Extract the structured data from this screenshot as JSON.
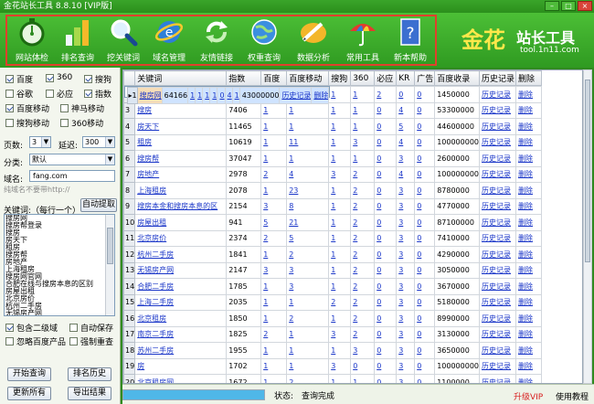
{
  "window": {
    "title": "金花站长工具 8.8.10 [VIP版]"
  },
  "toolbar": {
    "items": [
      {
        "label": "网站体检",
        "icon": "stopwatch-icon"
      },
      {
        "label": "排名查询",
        "icon": "bar-chart-icon"
      },
      {
        "label": "挖关键词",
        "icon": "magnifier-icon"
      },
      {
        "label": "域名管理",
        "icon": "ie-globe-icon"
      },
      {
        "label": "友情链接",
        "icon": "refresh-icon"
      },
      {
        "label": "权重查询",
        "icon": "globe-icon"
      },
      {
        "label": "数据分析",
        "icon": "pen-icon"
      },
      {
        "label": "常用工具",
        "icon": "umbrella-icon"
      },
      {
        "label": "新本帮助",
        "icon": "help-book-icon"
      }
    ],
    "logo_text_1": "金花",
    "logo_text_2": "站长工具",
    "logo_url": "tool.1n11.com"
  },
  "left": {
    "engines": [
      {
        "label": "百度",
        "checked": true
      },
      {
        "label": "360",
        "checked": true
      },
      {
        "label": "搜狗",
        "checked": true
      },
      {
        "label": "谷歌",
        "checked": false
      },
      {
        "label": "必应",
        "checked": false
      },
      {
        "label": "指数",
        "checked": true
      },
      {
        "label": "百度移动",
        "checked": true
      },
      {
        "label": "神马移动",
        "checked": false
      },
      {
        "label": "搜狗移动",
        "checked": false
      },
      {
        "label": "360移动",
        "checked": false
      }
    ],
    "pages_label": "页数:",
    "pages_value": "3",
    "delay_label": "延迟:",
    "delay_value": "300",
    "category_label": "分类:",
    "category_value": "默认",
    "domain_label": "域名:",
    "domain_value": "fang.com",
    "domain_hint": "纯域名不要带http://",
    "keywords_label": "关键词:（每行一个）",
    "auto_fetch": "自动提取",
    "keywords": [
      "搜房网",
      "搜房帮登录",
      "搜房",
      "房天下",
      "租房",
      "搜房帮",
      "房地产",
      "上海租房",
      "搜房网官网",
      "合肥在线与搜房本息的区别",
      "房屋出租",
      "北京房价",
      "杭州二手房",
      "无锡房产网"
    ],
    "options": [
      {
        "label": "包含二级域",
        "checked": true
      },
      {
        "label": "自动保存",
        "checked": false
      },
      {
        "label": "忽略百度产品",
        "checked": false
      },
      {
        "label": "强制重查",
        "checked": false
      }
    ],
    "buttons": {
      "start": "开始查询",
      "history": "排名历史",
      "update_all": "更新所有",
      "export": "导出结果"
    }
  },
  "grid": {
    "headers": [
      "",
      "关键词",
      "指数",
      "百度",
      "百度移动",
      "搜狗",
      "360",
      "必应",
      "KR",
      "广告",
      "百度收录",
      "历史记录",
      "删除"
    ],
    "rows": [
      [
        "1",
        "搜房网",
        "64166",
        "1",
        "1",
        "1",
        "1",
        "0",
        "4",
        "1",
        "43000000",
        "历史记录",
        "删除"
      ],
      [
        "2",
        "搜房帮登录",
        "14739",
        "1",
        "1",
        "1",
        "1",
        "2",
        "0",
        "0",
        "1450000",
        "历史记录",
        "删除"
      ],
      [
        "3",
        "搜房",
        "7406",
        "1",
        "1",
        "1",
        "1",
        "0",
        "4",
        "0",
        "53300000",
        "历史记录",
        "删除"
      ],
      [
        "4",
        "房天下",
        "11465",
        "1",
        "1",
        "1",
        "1",
        "0",
        "5",
        "0",
        "44600000",
        "历史记录",
        "删除"
      ],
      [
        "5",
        "租房",
        "10619",
        "1",
        "11",
        "1",
        "3",
        "0",
        "4",
        "0",
        "100000000",
        "历史记录",
        "删除"
      ],
      [
        "6",
        "搜房帮",
        "37047",
        "1",
        "1",
        "1",
        "1",
        "0",
        "3",
        "0",
        "2600000",
        "历史记录",
        "删除"
      ],
      [
        "7",
        "房地产",
        "2978",
        "2",
        "4",
        "3",
        "2",
        "0",
        "4",
        "0",
        "100000000",
        "历史记录",
        "删除"
      ],
      [
        "8",
        "上海租房",
        "2078",
        "1",
        "23",
        "1",
        "2",
        "0",
        "3",
        "0",
        "8780000",
        "历史记录",
        "删除"
      ],
      [
        "9",
        "搜房本金和搜房本息的区",
        "2154",
        "3",
        "8",
        "1",
        "2",
        "0",
        "3",
        "0",
        "4770000",
        "历史记录",
        "删除"
      ],
      [
        "10",
        "房屋出租",
        "941",
        "5",
        "21",
        "1",
        "2",
        "0",
        "3",
        "0",
        "87100000",
        "历史记录",
        "删除"
      ],
      [
        "11",
        "北京房价",
        "2374",
        "2",
        "5",
        "1",
        "2",
        "0",
        "3",
        "0",
        "7410000",
        "历史记录",
        "删除"
      ],
      [
        "12",
        "杭州二手房",
        "1841",
        "1",
        "2",
        "1",
        "2",
        "0",
        "3",
        "0",
        "4290000",
        "历史记录",
        "删除"
      ],
      [
        "13",
        "无锡房产网",
        "2147",
        "3",
        "3",
        "1",
        "2",
        "0",
        "3",
        "0",
        "3050000",
        "历史记录",
        "删除"
      ],
      [
        "14",
        "合肥二手房",
        "1785",
        "1",
        "3",
        "1",
        "2",
        "0",
        "3",
        "0",
        "3670000",
        "历史记录",
        "删除"
      ],
      [
        "15",
        "上海二手房",
        "2035",
        "1",
        "1",
        "2",
        "2",
        "0",
        "3",
        "0",
        "5180000",
        "历史记录",
        "删除"
      ],
      [
        "16",
        "北京租房",
        "1850",
        "1",
        "2",
        "1",
        "2",
        "0",
        "3",
        "0",
        "8990000",
        "历史记录",
        "删除"
      ],
      [
        "17",
        "南京二手房",
        "1825",
        "2",
        "1",
        "3",
        "2",
        "0",
        "3",
        "0",
        "3130000",
        "历史记录",
        "删除"
      ],
      [
        "18",
        "苏州二手房",
        "1955",
        "1",
        "1",
        "1",
        "3",
        "0",
        "3",
        "0",
        "3650000",
        "历史记录",
        "删除"
      ],
      [
        "19",
        "房",
        "1702",
        "1",
        "1",
        "3",
        "0",
        "0",
        "3",
        "0",
        "100000000",
        "历史记录",
        "删除"
      ],
      [
        "20",
        "北京租房网",
        "1672",
        "1",
        "2",
        "1",
        "1",
        "0",
        "3",
        "0",
        "1100000",
        "历史记录",
        "删除"
      ],
      [
        "21",
        "前3总计:",
        "0",
        "19",
        "14",
        "16",
        "11",
        "",
        "",
        "",
        "",
        "",
        ""
      ]
    ]
  },
  "status": {
    "progress": 1.0,
    "label": "状态:",
    "value": "查询完成",
    "upgrade": "升级VIP",
    "tutorial": "使用教程"
  }
}
